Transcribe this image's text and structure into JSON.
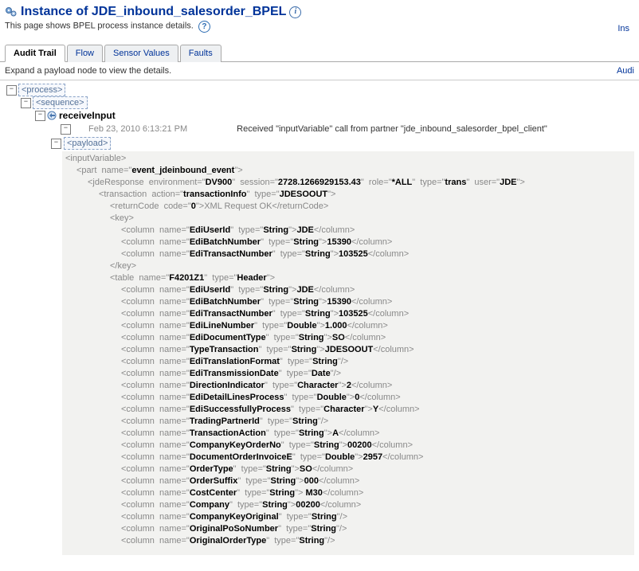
{
  "header": {
    "title": "Instance of JDE_inbound_salesorder_BPEL",
    "subtitle": "This page shows BPEL process instance details.",
    "right_trunc": "Ins"
  },
  "tabs": {
    "items": [
      "Audit Trail",
      "Flow",
      "Sensor Values",
      "Faults"
    ],
    "active_index": 0
  },
  "expand_bar": {
    "text": "Expand a payload node to view the details.",
    "right": "Audi"
  },
  "tree": {
    "process": "<process>",
    "sequence": "<sequence>",
    "receive_label": "receiveInput",
    "timestamp": "Feb 23, 2010 6:13:21 PM",
    "message": "Received \"inputVariable\" call from partner \"jde_inbound_salesorder_bpel_client\"",
    "payload": "<payload>"
  },
  "xml": {
    "inputVariable": "<inputVariable>",
    "part_name": "event_jdeinbound_event",
    "jdeResponse": {
      "environment": "DV900",
      "session": "2728.1266929153.43",
      "role": "*ALL",
      "type": "trans",
      "user": "JDE"
    },
    "transaction": {
      "action": "transactionInfo",
      "type": "JDESOOUT"
    },
    "returnCode": {
      "code": "0",
      "text": "XML Request OK"
    },
    "key_columns": [
      {
        "name": "EdiUserId",
        "type": "String",
        "value": "JDE"
      },
      {
        "name": "EdiBatchNumber",
        "type": "String",
        "value": "15390"
      },
      {
        "name": "EdiTransactNumber",
        "type": "String",
        "value": "103525"
      }
    ],
    "table": {
      "name": "F4201Z1",
      "type": "Header"
    },
    "table_columns": [
      {
        "name": "EdiUserId",
        "type": "String",
        "value": "JDE"
      },
      {
        "name": "EdiBatchNumber",
        "type": "String",
        "value": "15390"
      },
      {
        "name": "EdiTransactNumber",
        "type": "String",
        "value": "103525"
      },
      {
        "name": "EdiLineNumber",
        "type": "Double",
        "value": "1.000"
      },
      {
        "name": "EdiDocumentType",
        "type": "String",
        "value": "SO"
      },
      {
        "name": "TypeTransaction",
        "type": "String",
        "value": "JDESOOUT"
      },
      {
        "name": "EdiTranslationFormat",
        "type": "String",
        "self_close": true
      },
      {
        "name": "EdiTransmissionDate",
        "type": "Date",
        "self_close": true
      },
      {
        "name": "DirectionIndicator",
        "type": "Character",
        "value": "2"
      },
      {
        "name": "EdiDetailLinesProcess",
        "type": "Double",
        "value": "0"
      },
      {
        "name": "EdiSuccessfullyProcess",
        "type": "Character",
        "value": "Y"
      },
      {
        "name": "TradingPartnerId",
        "type": "String",
        "self_close": true
      },
      {
        "name": "TransactionAction",
        "type": "String",
        "value": "A"
      },
      {
        "name": "CompanyKeyOrderNo",
        "type": "String",
        "value": "00200"
      },
      {
        "name": "DocumentOrderInvoiceE",
        "type": "Double",
        "value": "2957"
      },
      {
        "name": "OrderType",
        "type": "String",
        "value": "SO"
      },
      {
        "name": "OrderSuffix",
        "type": "String",
        "value": "000"
      },
      {
        "name": "CostCenter",
        "type": "String",
        "value": " M30"
      },
      {
        "name": "Company",
        "type": "String",
        "value": "00200"
      },
      {
        "name": "CompanyKeyOriginal",
        "type": "String",
        "self_close": true
      },
      {
        "name": "OriginalPoSoNumber",
        "type": "String",
        "self_close": true
      },
      {
        "name": "OriginalOrderType",
        "type": "String",
        "self_close": true
      }
    ]
  }
}
